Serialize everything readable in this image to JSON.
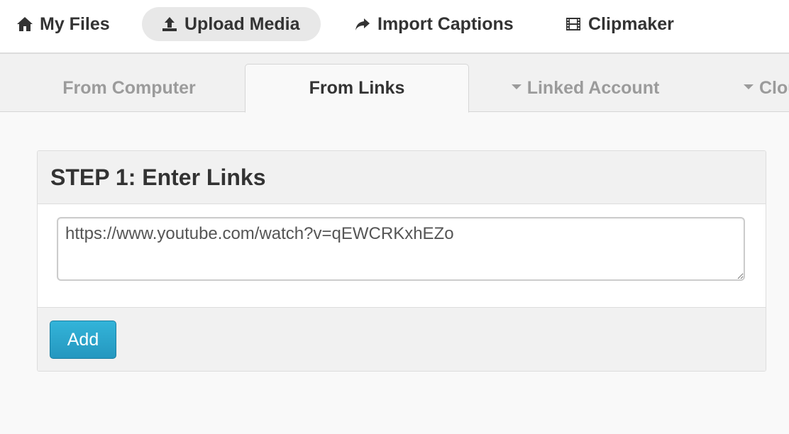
{
  "nav": {
    "my_files": "My Files",
    "upload_media": "Upload Media",
    "import_captions": "Import Captions",
    "clipmaker": "Clipmaker"
  },
  "icons": {
    "my_files": "home-icon",
    "upload_media": "upload-icon",
    "import_captions": "share-arrow-icon",
    "clipmaker": "film-icon"
  },
  "tabs": {
    "from_computer": "From Computer",
    "from_links": "From Links",
    "linked_account": "Linked Account",
    "cloud": "Clou"
  },
  "step": {
    "title": "STEP 1: Enter Links",
    "link_value": "https://www.youtube.com/watch?v=qEWCRKxhEZo",
    "add_label": "Add"
  },
  "colors": {
    "accent": "#2a9fc9",
    "active_nav_bg": "#e8e8e8",
    "text_dark": "#333333",
    "text_muted": "#9b9b9b"
  }
}
